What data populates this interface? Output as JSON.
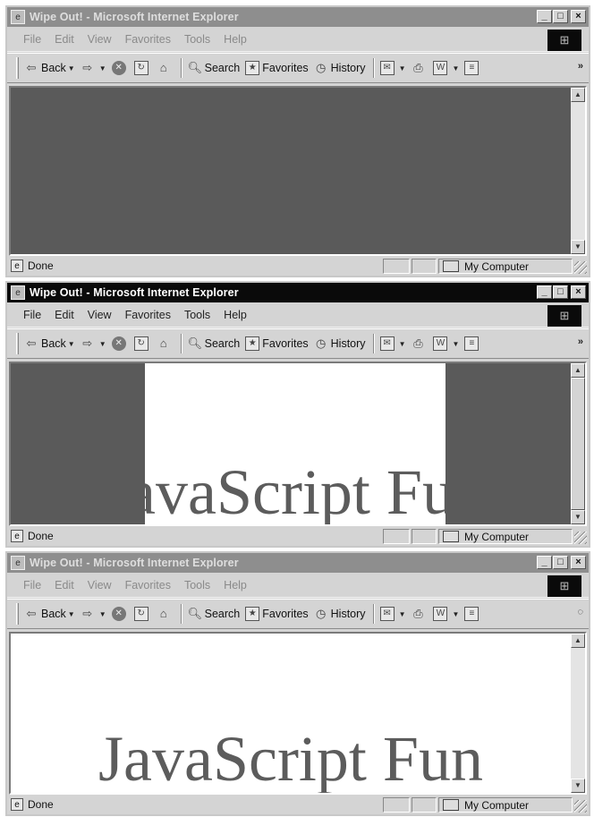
{
  "windows": [
    {
      "title": "Wipe Out! - Microsoft Internet Explorer",
      "active": false,
      "status": "Done",
      "zone": "My Computer",
      "page_text": ""
    },
    {
      "title": "Wipe Out! - Microsoft Internet Explorer",
      "active": true,
      "status": "Done",
      "zone": "My Computer",
      "page_text": "JavaScript Fun",
      "wipe_progress": 0.53
    },
    {
      "title": "Wipe Out! - Microsoft Internet Explorer",
      "active": false,
      "status": "Done",
      "zone": "My Computer",
      "page_text": "JavaScript Fun"
    }
  ],
  "menu": {
    "file": "File",
    "edit": "Edit",
    "view": "View",
    "favorites": "Favorites",
    "tools": "Tools",
    "help": "Help"
  },
  "toolbar": {
    "back": "Back",
    "search": "Search",
    "favorites": "Favorites",
    "history": "History",
    "more": "»"
  },
  "controls": {
    "minimize": "_",
    "maximize": "□",
    "close": "×"
  },
  "colors": {
    "active_title": "#0a0a0a",
    "inactive_title": "#8e8e8e",
    "content_gray": "#5a5a5a",
    "page_bg": "#ffffff"
  }
}
